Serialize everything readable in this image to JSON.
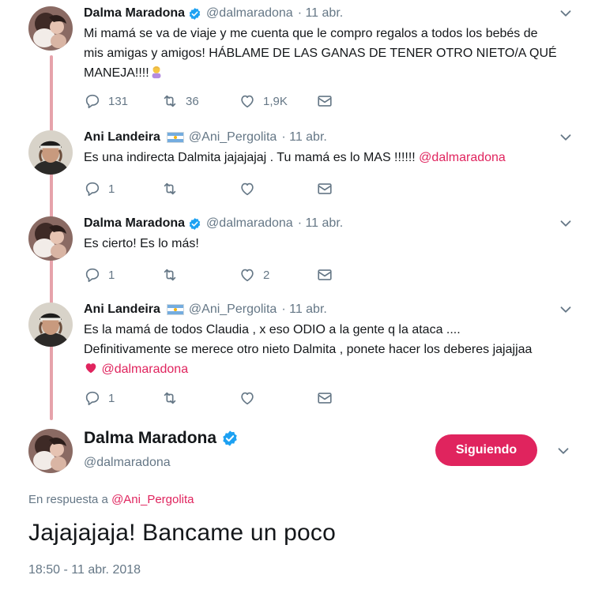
{
  "tweets": [
    {
      "name": "Dalma Maradona",
      "handle": "@dalmaradona",
      "date": "· 11 abr.",
      "text_line1": "Mi mamá se va de viaje y me cuenta que le compro regalos a todos los bebés de",
      "text_line2": "mis amigas y amigos! HÁBLAME DE LAS GANAS DE TENER OTRO NIETO/A QUÉ",
      "text_line3": "MANEJA!!!!",
      "replies": "131",
      "retweets": "36",
      "likes": "1,9K"
    },
    {
      "name": "Ani Landeira",
      "handle": "@Ani_Pergolita",
      "date": "· 11 abr.",
      "text": "Es una indirecta Dalmita jajajajaj . Tu mamá es lo MAS !!!!!! ",
      "mention": "@dalmaradona",
      "replies": "1",
      "retweets": "",
      "likes": ""
    },
    {
      "name": "Dalma Maradona",
      "handle": "@dalmaradona",
      "date": "· 11 abr.",
      "text": "Es cierto! Es lo más!",
      "replies": "1",
      "retweets": "",
      "likes": "2"
    },
    {
      "name": "Ani Landeira",
      "handle": "@Ani_Pergolita",
      "date": "· 11 abr.",
      "text_line1": "Es la mamá de todos Claudia , x eso ODIO a la gente q la ataca ....",
      "text_line2": "Definitivamente se merece otro nieto Dalmita , ponete hacer los deberes jajajjaa",
      "mention": "@dalmaradona",
      "replies": "1",
      "retweets": "",
      "likes": ""
    }
  ],
  "main": {
    "name": "Dalma Maradona",
    "handle": "@dalmaradona",
    "follow_label": "Siguiendo",
    "reply_prefix": "En respuesta a ",
    "reply_mention": "@Ani_Pergolita",
    "text": "Jajajajaja! Bancame un poco",
    "timestamp": "18:50 - 11 abr. 2018"
  },
  "colors": {
    "accent": "#e0245e",
    "verified": "#1da1f2",
    "thread_line": "#e6a3ab",
    "secondary_text": "#657786"
  },
  "icons": [
    "verified-icon",
    "chevron-down-icon",
    "reply-icon",
    "retweet-icon",
    "like-icon",
    "message-icon",
    "argentina-flag-icon",
    "emoji-woman-shrugging-icon",
    "heart-emoji-icon"
  ]
}
